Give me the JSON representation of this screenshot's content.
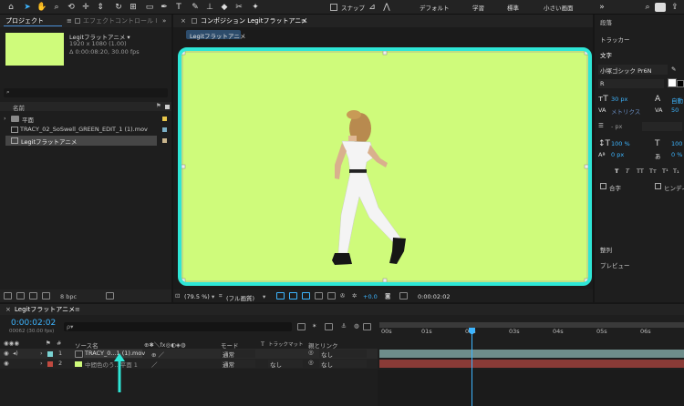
{
  "toolbar": {
    "snap_label": "スナップ",
    "workspaces": [
      "デフォルト",
      "学習",
      "標準",
      "小さい画面"
    ]
  },
  "project": {
    "tab_label": "プロジェクト",
    "effect_tab_label": "エフェクトコントロール Ⅰ",
    "comp_name": "Legitフラットアニメ ▾",
    "comp_size": "1920 x 1080 (1.00)",
    "comp_duration": "Δ 0:00:08:20, 30.00 fps",
    "column_name": "名前",
    "items": [
      {
        "label": "平面",
        "kind": "folder",
        "color": "#e8c64a"
      },
      {
        "label": "TRACY_02_SoSwell_GREEN_EDIT_1 (1).mov",
        "kind": "video",
        "color": "#7aaec4"
      },
      {
        "label": "Legitフラットアニメ",
        "kind": "comp",
        "color": "#c8b48c"
      }
    ],
    "bpc_label": "8 bpc"
  },
  "composition": {
    "tab_label": "コンポジション Legitフラットアニメ",
    "subtab_label": "Legitフラットアニメ",
    "zoom": "(79.5 %)",
    "quality": "(フル画質)",
    "exposure": "+0.0",
    "timecode": "0:00:02:02"
  },
  "right_panel": {
    "info": "段落",
    "tracker": "トラッカー",
    "character": "文字",
    "font_name": "小塚ゴシック Pr6N",
    "font_style": "R",
    "font_size": "30 px",
    "leading": "自動",
    "kerning": "メトリクス",
    "tracking": "50",
    "stroke": "- px",
    "vscale": "100 %",
    "hscale": "100 %",
    "baseline": "0 px",
    "tsume": "0 %",
    "faux_styles": [
      "T",
      "T",
      "TT",
      "Tт",
      "T¹",
      "T₁"
    ],
    "ligature_label": "合字",
    "hindi_label": "ヒンディ",
    "align": "整列",
    "preview": "プレビュー"
  },
  "timeline": {
    "tab_label": "Legitフラットアニメ",
    "timecode": "0:00:02:02",
    "frame_info": "00062 (30.00 fps)",
    "search_placeholder": "ρ▾",
    "col_source": "ソース名",
    "col_mode": "モード",
    "col_t": "T",
    "col_trackmatte": "トラックマット",
    "col_parent": "親とリンク",
    "ruler": [
      "00s",
      "01s",
      "02s",
      "03s",
      "04s",
      "05s",
      "06s"
    ],
    "layers": [
      {
        "num": "1",
        "name": "TRACY_0...1 (1).mov",
        "label_color": "#7ad3d3",
        "mode": "通常",
        "matte": "",
        "parent": "なし",
        "bar_color": "#6e8d8a"
      },
      {
        "num": "2",
        "name": "中間色のう...平面 1",
        "label_color": "#c04a40",
        "mode": "通常",
        "matte": "なし",
        "parent": "なし",
        "bar_color": "#8a3b37"
      }
    ]
  },
  "colors": {
    "accent": "#3db5ff",
    "highlight": "#2ee6d6",
    "canvas": "#cffb7b",
    "panel": "#1e1e1e"
  }
}
